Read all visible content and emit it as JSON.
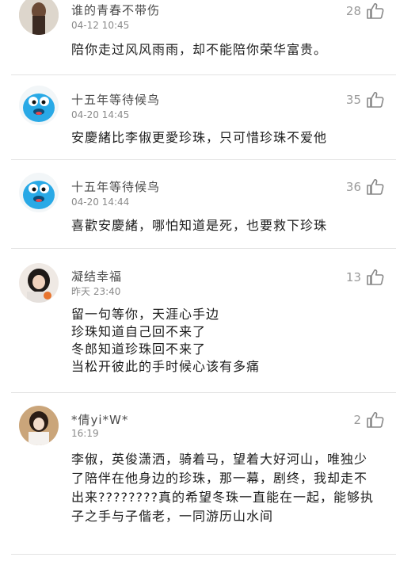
{
  "comments": [
    {
      "username": "谁的青春不带伤",
      "time": "04-12 10:45",
      "likes": "28",
      "avatar_icon": "avatar-photo-icon",
      "lines": [
        "陪你走过风风雨雨，却不能陪你荣华富贵。"
      ]
    },
    {
      "username": "十五年等待候鸟",
      "time": "04-20 14:45",
      "likes": "35",
      "avatar_icon": "blue-cartoon-avatar-icon",
      "lines": [
        "安慶緒比李俶更愛珍珠，只可惜珍珠不爱他"
      ]
    },
    {
      "username": "十五年等待候鸟",
      "time": "04-20 14:44",
      "likes": "36",
      "avatar_icon": "blue-cartoon-avatar-icon",
      "lines": [
        "喜歡安慶緒，哪怕知道是死，也要救下珍珠"
      ]
    },
    {
      "username": "凝结幸福",
      "time": "昨天 23:40",
      "likes": "13",
      "avatar_icon": "avatar-photo-icon",
      "lines": [
        "留一句等你，天涯心手边",
        "珍珠知道自己回不来了",
        "冬郎知道珍珠回不来了",
        "当松开彼此的手时候心该有多痛"
      ]
    },
    {
      "username": "*倩yi*W*",
      "time": "16:19",
      "likes": "2",
      "avatar_icon": "avatar-photo-icon",
      "lines": [
        "李俶，英俊潇洒，骑着马，望着大好河山，唯独少了陪伴在他身边的珍珠，那一幕，剧终，我却走不出来????????真的希望冬珠一直能在一起，能够执子之手与子偕老，一同游历山水间"
      ]
    }
  ],
  "colors": {
    "text": "#1c1c1c",
    "meta": "#8a8a8a",
    "divider": "#e3e3e3",
    "cartoon_blue": "#29a9e6"
  }
}
